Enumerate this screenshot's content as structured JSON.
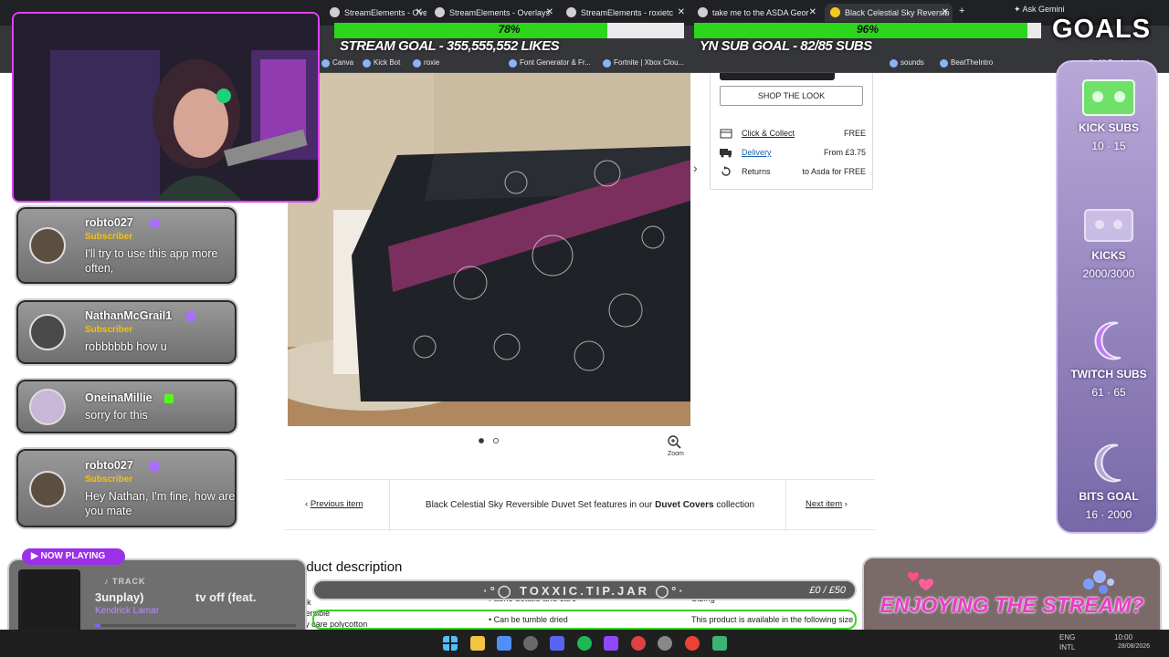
{
  "browser": {
    "tabs": [
      {
        "label": "StreamElements - Overlays",
        "active": false
      },
      {
        "label": "StreamElements - Overlays",
        "active": false
      },
      {
        "label": "StreamElements - roxietc",
        "active": false
      },
      {
        "label": "take me to the ASDA Geor",
        "active": false
      },
      {
        "label": "Black Celestial Sky Reversib",
        "active": true
      }
    ],
    "gemini_label": "Ask Gemini",
    "bookmarks": [
      "Canva",
      "Kick Bot",
      "roxie",
      "Font Generator & Fr...",
      "Fortnite | Xbox Clou...",
      "sounds",
      "BeatTheIntro",
      "All Bookmarks"
    ]
  },
  "product": {
    "shop_the_look": "SHOP THE LOOK",
    "shipping": [
      {
        "icon": "store-icon",
        "label": "Click & Collect",
        "value": "FREE"
      },
      {
        "icon": "truck-icon",
        "label": "Delivery",
        "value": "From £3.75"
      },
      {
        "icon": "return-icon",
        "label": "Returns",
        "value": "to Asda for FREE"
      }
    ],
    "zoom_label": "Zoom",
    "carousel_dots": 2,
    "carousel_active": 1,
    "nav": {
      "previous": "Previous item",
      "next": "Next item",
      "collection_prefix": "Black Celestial Sky Reversible Duvet Set features in our",
      "collection_link": "Duvet Covers",
      "collection_suffix": "collection"
    },
    "description_title": "Product description",
    "details_header": "Fabric details and care",
    "sizing_header": "Sizing",
    "bullets_left": [
      "Black",
      "Reversible",
      "Easy care polycotton"
    ],
    "care_bullet": "Can be tumble dried",
    "sizing_text": "This product is available in the following size"
  },
  "overlay": {
    "goals": [
      {
        "percent_label": "78%",
        "fraction": 0.78,
        "text": "STREAM GOAL - 355,555,552 LIKES"
      },
      {
        "percent_label": "96%",
        "fraction": 0.96,
        "text": "YN SUB GOAL - 82/85 SUBS"
      }
    ],
    "goals_title": "GOALS",
    "side_items": [
      {
        "name": "KICK SUBS",
        "value": "10 · 15"
      },
      {
        "name": "KICKS",
        "value": "2000/3000"
      },
      {
        "name": "TWITCH SUBS",
        "value": "61 · 65"
      },
      {
        "name": "BITS GOAL",
        "value": "16 · 2000"
      }
    ],
    "chat": [
      {
        "user": "robto027",
        "subscriber": "Subscriber",
        "message": "I'll try to use this app more often,"
      },
      {
        "user": "NathanMcGrail1",
        "subscriber": "Subscriber",
        "message": "robbbbbb how u"
      },
      {
        "user": "OneinaMillie",
        "subscriber": "",
        "message": "sorry for this"
      },
      {
        "user": "robto027",
        "subscriber": "Subscriber",
        "message": "Hey Nathan, I'm fine, how are you mate"
      }
    ],
    "now_playing": {
      "badge": "NOW PLAYING",
      "track_label": "TRACK",
      "song_part1": "3unplay)",
      "song_part2": "tv off (feat.",
      "artist": "Kendrick Lamar"
    },
    "tip_jar": {
      "text": "TOXXIC.TIP.JAR",
      "amount": "£0 / £50"
    },
    "enjoy_text": "ENJOYING THE STREAM?",
    "colors": {
      "goal_green": "#2cd61b",
      "accent_purple": "#9b30e8",
      "enjoy_pink": "#e93cc7"
    }
  },
  "taskbar": {
    "tray_lang": "ENG",
    "tray_region": "INTL",
    "time": "10:00",
    "date": "28/08/2026"
  }
}
